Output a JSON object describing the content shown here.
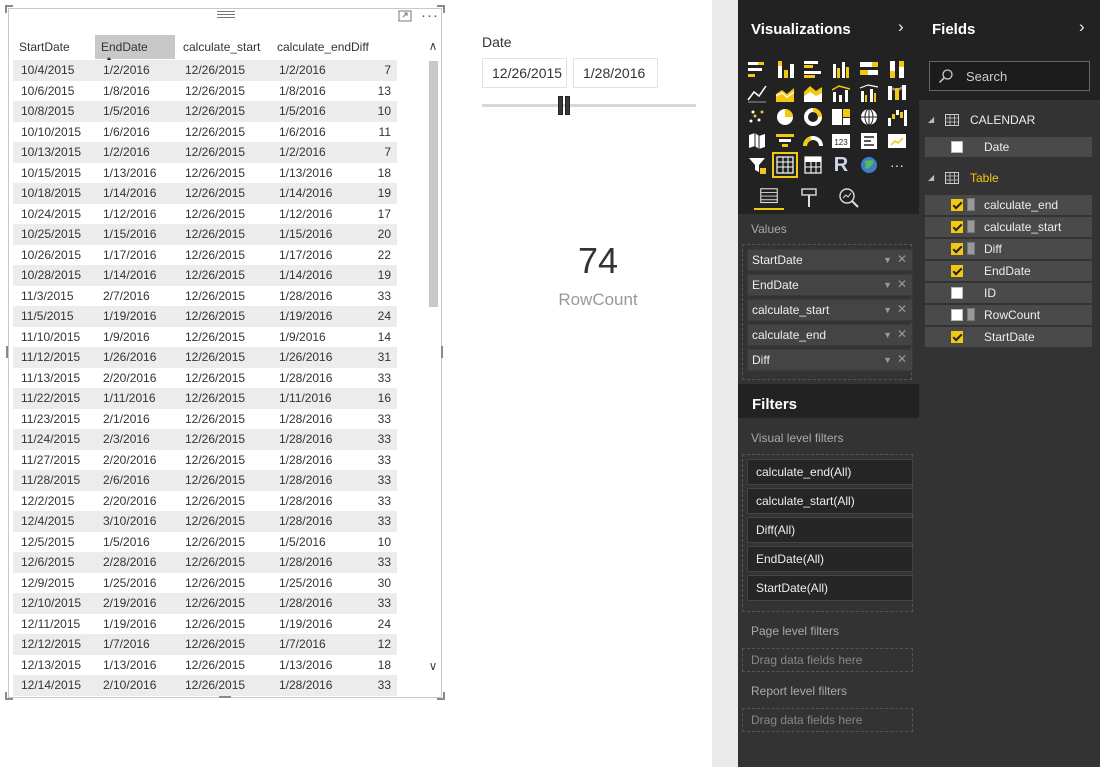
{
  "table": {
    "columns": [
      "StartDate",
      "EndDate",
      "calculate_start",
      "calculate_end",
      "Diff"
    ],
    "sorted_column": "EndDate",
    "rows": [
      [
        "10/4/2015",
        "1/2/2016",
        "12/26/2015",
        "1/2/2016",
        "7"
      ],
      [
        "10/6/2015",
        "1/8/2016",
        "12/26/2015",
        "1/8/2016",
        "13"
      ],
      [
        "10/8/2015",
        "1/5/2016",
        "12/26/2015",
        "1/5/2016",
        "10"
      ],
      [
        "10/10/2015",
        "1/6/2016",
        "12/26/2015",
        "1/6/2016",
        "11"
      ],
      [
        "10/13/2015",
        "1/2/2016",
        "12/26/2015",
        "1/2/2016",
        "7"
      ],
      [
        "10/15/2015",
        "1/13/2016",
        "12/26/2015",
        "1/13/2016",
        "18"
      ],
      [
        "10/18/2015",
        "1/14/2016",
        "12/26/2015",
        "1/14/2016",
        "19"
      ],
      [
        "10/24/2015",
        "1/12/2016",
        "12/26/2015",
        "1/12/2016",
        "17"
      ],
      [
        "10/25/2015",
        "1/15/2016",
        "12/26/2015",
        "1/15/2016",
        "20"
      ],
      [
        "10/26/2015",
        "1/17/2016",
        "12/26/2015",
        "1/17/2016",
        "22"
      ],
      [
        "10/28/2015",
        "1/14/2016",
        "12/26/2015",
        "1/14/2016",
        "19"
      ],
      [
        "11/3/2015",
        "2/7/2016",
        "12/26/2015",
        "1/28/2016",
        "33"
      ],
      [
        "11/5/2015",
        "1/19/2016",
        "12/26/2015",
        "1/19/2016",
        "24"
      ],
      [
        "11/10/2015",
        "1/9/2016",
        "12/26/2015",
        "1/9/2016",
        "14"
      ],
      [
        "11/12/2015",
        "1/26/2016",
        "12/26/2015",
        "1/26/2016",
        "31"
      ],
      [
        "11/13/2015",
        "2/20/2016",
        "12/26/2015",
        "1/28/2016",
        "33"
      ],
      [
        "11/22/2015",
        "1/11/2016",
        "12/26/2015",
        "1/11/2016",
        "16"
      ],
      [
        "11/23/2015",
        "2/1/2016",
        "12/26/2015",
        "1/28/2016",
        "33"
      ],
      [
        "11/24/2015",
        "2/3/2016",
        "12/26/2015",
        "1/28/2016",
        "33"
      ],
      [
        "11/27/2015",
        "2/20/2016",
        "12/26/2015",
        "1/28/2016",
        "33"
      ],
      [
        "11/28/2015",
        "2/6/2016",
        "12/26/2015",
        "1/28/2016",
        "33"
      ],
      [
        "12/2/2015",
        "2/20/2016",
        "12/26/2015",
        "1/28/2016",
        "33"
      ],
      [
        "12/4/2015",
        "3/10/2016",
        "12/26/2015",
        "1/28/2016",
        "33"
      ],
      [
        "12/5/2015",
        "1/5/2016",
        "12/26/2015",
        "1/5/2016",
        "10"
      ],
      [
        "12/6/2015",
        "2/28/2016",
        "12/26/2015",
        "1/28/2016",
        "33"
      ],
      [
        "12/9/2015",
        "1/25/2016",
        "12/26/2015",
        "1/25/2016",
        "30"
      ],
      [
        "12/10/2015",
        "2/19/2016",
        "12/26/2015",
        "1/28/2016",
        "33"
      ],
      [
        "12/11/2015",
        "1/19/2016",
        "12/26/2015",
        "1/19/2016",
        "24"
      ],
      [
        "12/12/2015",
        "1/7/2016",
        "12/26/2015",
        "1/7/2016",
        "12"
      ],
      [
        "12/13/2015",
        "1/13/2016",
        "12/26/2015",
        "1/13/2016",
        "18"
      ],
      [
        "12/14/2015",
        "2/10/2016",
        "12/26/2015",
        "1/28/2016",
        "33"
      ]
    ]
  },
  "slicer": {
    "title": "Date",
    "start": "12/26/2015",
    "end": "1/28/2016"
  },
  "card": {
    "value": "74",
    "label": "RowCount"
  },
  "visualizations": {
    "title": "Visualizations",
    "values_label": "Values",
    "wells": [
      "StartDate",
      "EndDate",
      "calculate_start",
      "calculate_end",
      "Diff"
    ],
    "gallery_icons": [
      "stacked-bar-icon",
      "stacked-column-icon",
      "clustered-bar-icon",
      "clustered-column-icon",
      "100-bar-icon",
      "100-column-icon",
      "line-chart-icon",
      "area-chart-icon",
      "stacked-area-icon",
      "line-column-icon",
      "line-clustered-column-icon",
      "ribbon-chart-icon",
      "scatter-icon",
      "pie-chart-icon",
      "donut-icon",
      "treemap-icon",
      "map-icon",
      "waterfall-icon",
      "filled-map-icon",
      "funnel-icon",
      "gauge-icon",
      "card-icon",
      "multirow-card-icon",
      "kpi-icon",
      "slicer-icon",
      "table-icon",
      "matrix-icon",
      "r-visual-icon",
      "globe-icon",
      "more-icon"
    ],
    "r_glyph": "R",
    "more_glyph": "···"
  },
  "filters": {
    "title": "Filters",
    "visual_level_label": "Visual level filters",
    "visual_level": [
      "calculate_end(All)",
      "calculate_start(All)",
      "Diff(All)",
      "EndDate(All)",
      "StartDate(All)"
    ],
    "page_level_label": "Page level filters",
    "report_level_label": "Report level filters",
    "drop_hint": "Drag data fields here"
  },
  "fields": {
    "title": "Fields",
    "search_placeholder": "Search",
    "tables": [
      {
        "name": "CALENDAR",
        "color": "#eeeeee",
        "fields": [
          {
            "name": "Date",
            "checked": false,
            "calculated": false
          }
        ]
      },
      {
        "name": "Table",
        "color": "#f2c811",
        "fields": [
          {
            "name": "calculate_end",
            "checked": true,
            "calculated": true
          },
          {
            "name": "calculate_start",
            "checked": true,
            "calculated": true
          },
          {
            "name": "Diff",
            "checked": true,
            "calculated": true
          },
          {
            "name": "EndDate",
            "checked": true,
            "calculated": false
          },
          {
            "name": "ID",
            "checked": false,
            "calculated": false
          },
          {
            "name": "RowCount",
            "checked": false,
            "calculated": true
          },
          {
            "name": "StartDate",
            "checked": true,
            "calculated": false
          }
        ]
      }
    ]
  },
  "colors": {
    "accent": "#f2c811",
    "pane_bg": "#333333",
    "header_bg": "#222222",
    "table_rule": "#1b7e74"
  }
}
